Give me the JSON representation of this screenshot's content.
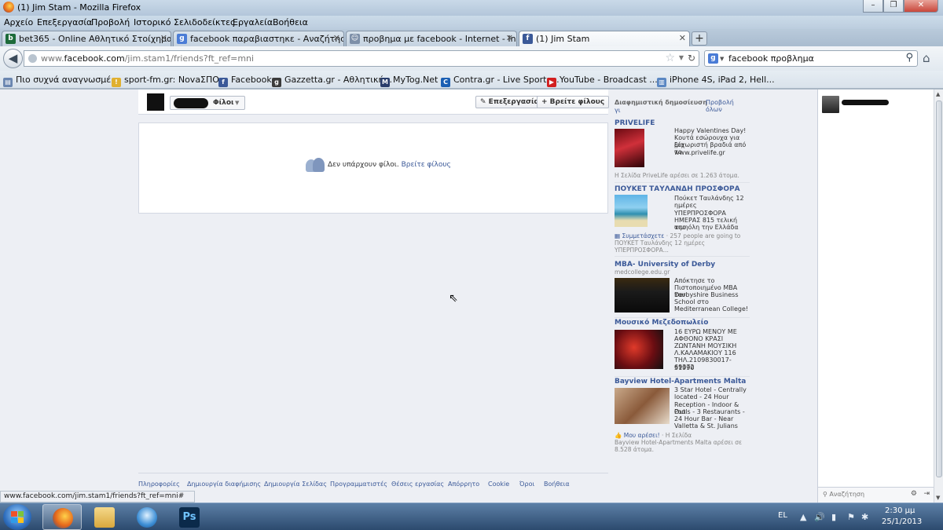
{
  "window": {
    "title": "(1) Jim Stam - Mozilla Firefox",
    "buttons": [
      "–",
      "❐",
      "✕"
    ]
  },
  "menu": [
    "Αρχείο",
    "Επεξεργασία",
    "Προβολή",
    "Ιστορικό",
    "Σελιδοδείκτες",
    "Εργαλεία",
    "Βοήθεια"
  ],
  "tabs": [
    {
      "label": "bet365 - Online Αθλητικό Στοίχημα",
      "icon": "bet365-icon",
      "color": "#1d6b3a",
      "glyph": "b"
    },
    {
      "label": "facebook παραβιαστηκε - Αναζήτηση...",
      "icon": "google-icon",
      "color": "#4a7cd6",
      "glyph": "g"
    },
    {
      "label": "προβημα με facebook - Internet - Ins...",
      "icon": "insomnia-icon",
      "color": "#7d8fa8",
      "glyph": "☺"
    },
    {
      "label": "(1) Jim Stam",
      "icon": "facebook-icon",
      "color": "#3b5998",
      "glyph": "f"
    }
  ],
  "newtab": "+",
  "url": {
    "prefix": "www.",
    "domain": "facebook.com",
    "path": "/jim.stam1/friends?ft_ref=mni"
  },
  "search": {
    "query": "facebook προβλημα",
    "engine": "g"
  },
  "bookmarks": [
    {
      "label": "Πιο συχνά αναγνωσμέ...",
      "color": "#6a86b0",
      "glyph": "▤"
    },
    {
      "label": "sport-fm.gr: NovaΣΠΟ...",
      "color": "#e0b030",
      "glyph": "!"
    },
    {
      "label": "Facebook",
      "color": "#3b5998",
      "glyph": "f"
    },
    {
      "label": "Gazzetta.gr - Αθλητική...",
      "color": "#3b3b3b",
      "glyph": "g"
    },
    {
      "label": "MyTog.Net",
      "color": "#2a3d6b",
      "glyph": "M"
    },
    {
      "label": "Contra.gr - Live Sports...",
      "color": "#1b5fb3",
      "glyph": "C"
    },
    {
      "label": "YouTube - Broadcast ...",
      "color": "#d21f1f",
      "glyph": "▶"
    },
    {
      "label": "iPhone 4S, iPad 2, Hell...",
      "color": "#5a87c2",
      "glyph": "▥"
    }
  ],
  "profile": {
    "friends_button": "Φίλοι",
    "edit_button": "✎ Επεξεργασία",
    "find_button": "+ Βρείτε φίλους",
    "empty_text": "Δεν υπάρχουν φίλοι.",
    "empty_link": "Βρείτε φίλους"
  },
  "sponsored": {
    "title": "Διαφημιστική δημοσίευση",
    "see_all": "Προβολή όλων",
    "see_all_2": "γι",
    "ads": [
      {
        "title": "PRIVELIFE",
        "lines": [
          "Happy Valentines Day!",
          "Κουτά εσώρουχα για μία",
          "ξεχωριστή βραδιά από το",
          "www.privelife.gr"
        ],
        "social": "Η Σελίδα PriveLife αρέσει σε 1.263 άτομα."
      },
      {
        "title": "ΠΟΥΚΕΤ ΤΑΥΛΑΝΔΗ ΠΡΟΣΦΟΡΑ",
        "lines": [
          "Πούκετ Ταυλάνδης 12",
          "ημέρες",
          "ΥΠΕΡΠΡΟΣΦΟΡΑ",
          "ΗΜΕΡΑΣ 815 τελική τιμη",
          "απο όλη την Ελλάδα"
        ],
        "social_link": "Συμμετάσχετε",
        "social": " · 257 people are going to",
        "social_2": "ΠΟΥΚΕΤ Ταυλάνδης 12 ημέρες",
        "social_3": "ΥΠΕΡΠΡΟΣΦΟΡΑ..."
      },
      {
        "title": "MBA- University of Derby",
        "domain": "medcollege.edu.gr",
        "lines": [
          "Απόκτησε το",
          "Πιστοποιημένο MBA του",
          "Derbyshire Business",
          "School στο",
          "Mediterranean College!"
        ]
      },
      {
        "title": "Μουσικό Μεζεδοπωλείο",
        "lines": [
          "16 ΕΥΡΩ ΜΕΝΟΥ ΜΕ",
          "ΑΦΘΟΝΟ ΚΡΑΣΙ",
          "ΖΩΝΤΑΝΗ ΜΟΥΣΙΚΗ",
          "Λ.ΚΑΛΑΜΑΚΙΟΥ 116",
          "ΤΗΛ.2109830017-69372",
          "51990"
        ]
      },
      {
        "title": "Bayview Hotel-Apartments Malta",
        "lines": [
          "3 Star Hotel - Centrally",
          "located - 24 Hour",
          "Reception - Indoor & Out",
          "Pools - 3 Restaurants -",
          "24 Hour Bar - Near",
          "Valletta & St. Julians"
        ],
        "social_link": "Μου αρέσει!",
        "social": " · Η Σελίδα",
        "social_2": "Bayview Hotel-Apartments Malta αρέσει σε",
        "social_3": "8.528 άτομα."
      }
    ]
  },
  "footer": [
    "Πληροφορίες",
    "Δημιουργία διαφήμισης",
    "Δημιουργία Σελίδας",
    "Προγραμματιστές",
    "Θέσεις εργασίας",
    "Απόρρητο",
    "Cookie",
    "Όροι",
    "Βοήθεια"
  ],
  "chat": {
    "search_placeholder": "Αναζήτηση",
    "gear": "⚙",
    "popout": "⇥"
  },
  "status_url": "www.facebook.com/jim.stam1/friends?ft_ref=mni#",
  "taskbar": {
    "apps": [
      {
        "name": "firefox",
        "active": true
      },
      {
        "name": "explorer",
        "active": false
      },
      {
        "name": "itunes",
        "active": false
      },
      {
        "name": "photoshop",
        "active": false,
        "label": "Ps"
      }
    ],
    "lang": "EL",
    "time": "2:30 μμ",
    "date": "25/1/2013"
  }
}
